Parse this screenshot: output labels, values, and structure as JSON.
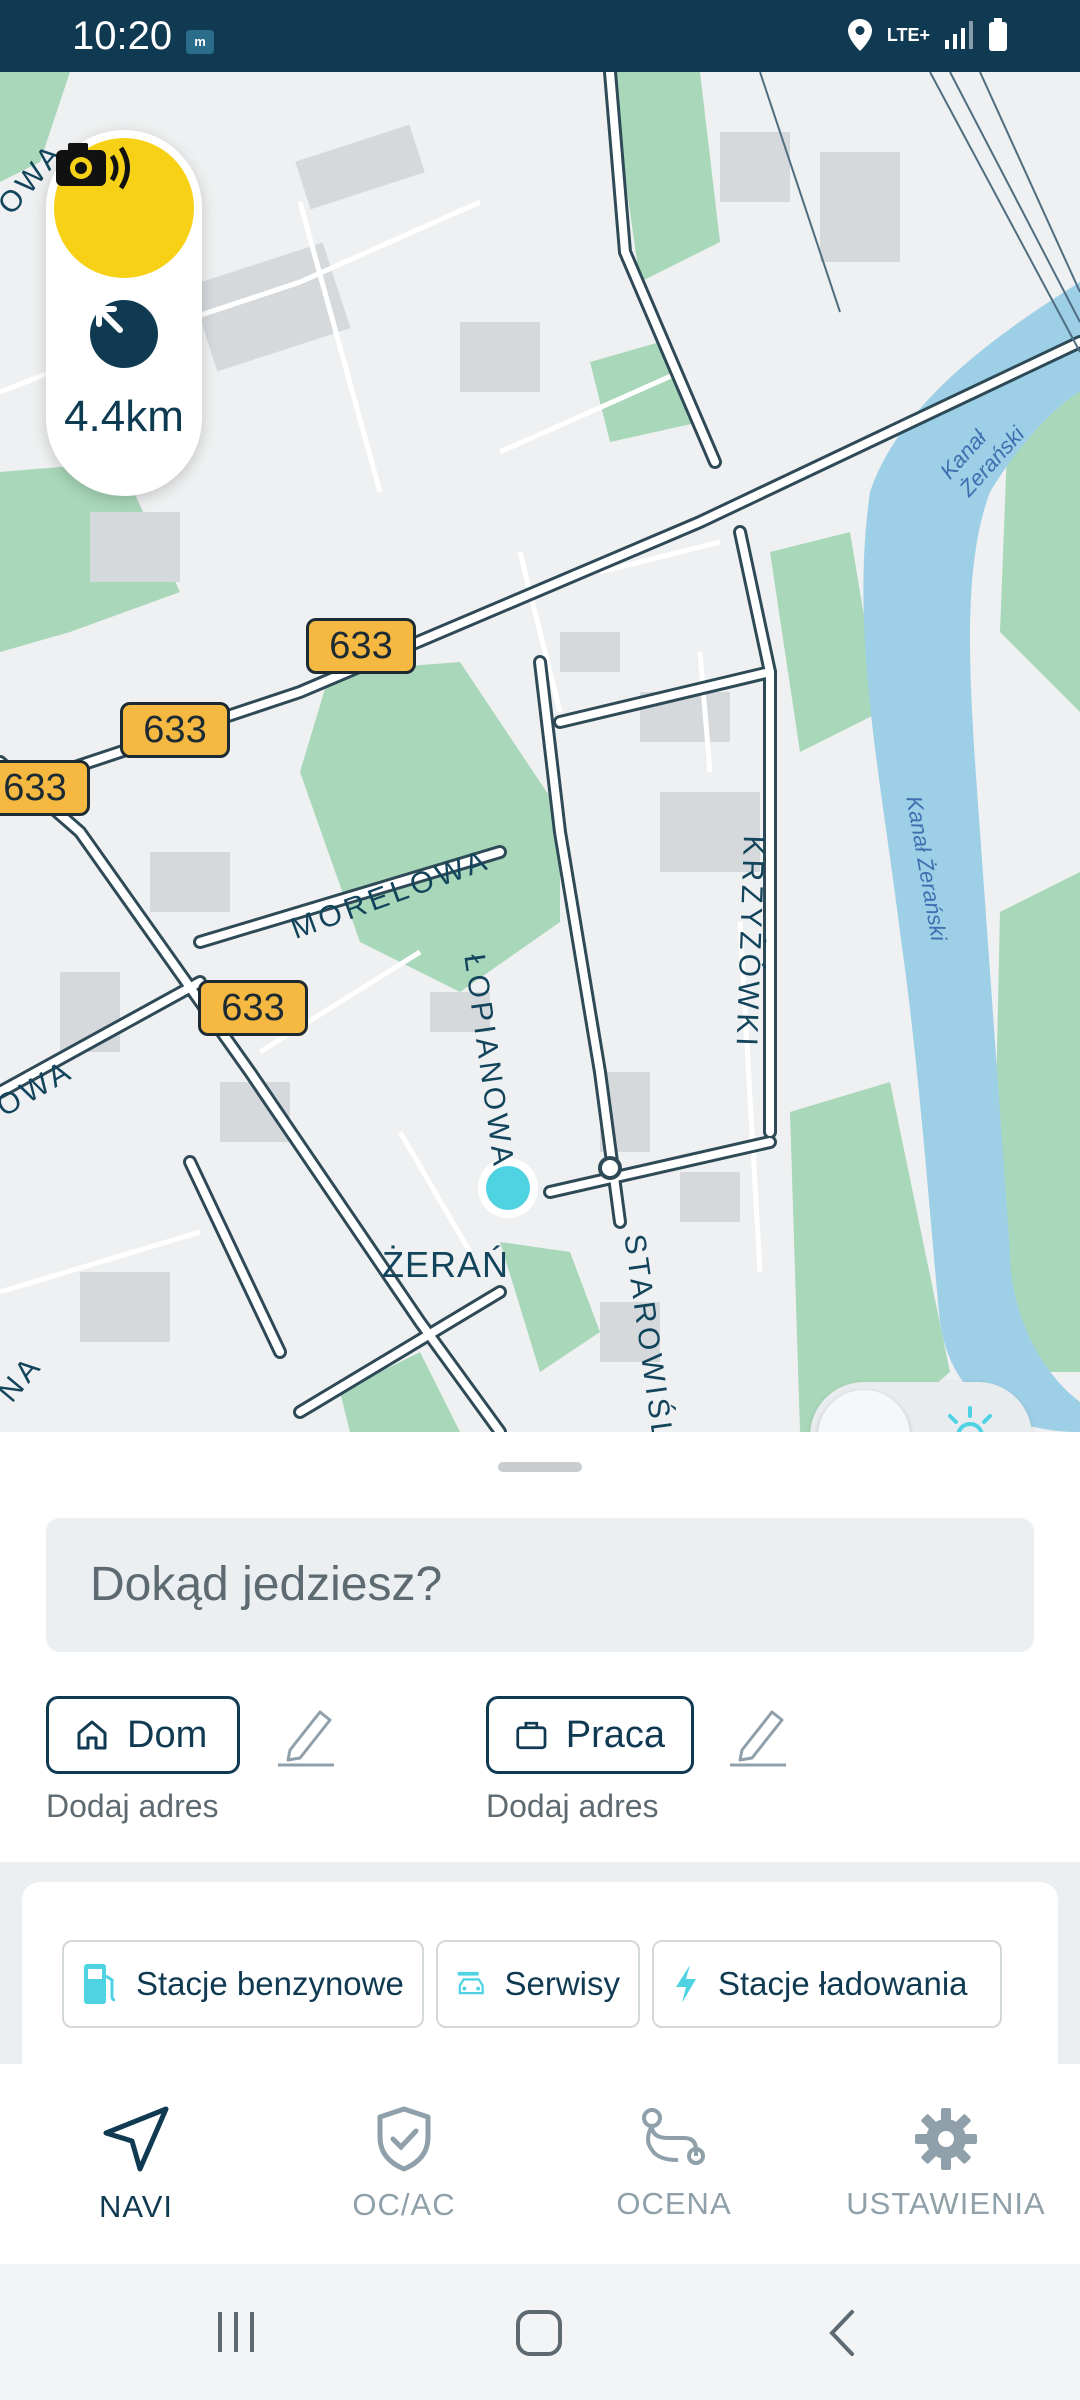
{
  "status_bar": {
    "time": "10:20",
    "notification_badge": "m",
    "network": "LTE+"
  },
  "map": {
    "camera_widget": {
      "distance": "4.4km"
    },
    "road_badges": [
      "633",
      "633",
      "633",
      "633"
    ],
    "street_labels": [
      "MORELOWA",
      "ŁOPIANOWA",
      "KRZYŻÓWKI",
      "STAROWIŚLNA",
      "OWA",
      "OWA",
      "NA"
    ],
    "district_label": "ŻERAŃ",
    "water_labels": [
      "Kanał Żerański",
      "Kanał Żerański"
    ],
    "theme_toggle": {
      "mode": "light"
    }
  },
  "search": {
    "placeholder": "Dokąd jedziesz?"
  },
  "favorites": [
    {
      "label": "Dom",
      "sub": "Dodaj adres",
      "icon": "home-icon"
    },
    {
      "label": "Praca",
      "sub": "Dodaj adres",
      "icon": "briefcase-icon"
    }
  ],
  "categories": [
    {
      "label": "Stacje benzynowe",
      "icon": "fuel-pump-icon"
    },
    {
      "label": "Serwisy",
      "icon": "car-service-icon"
    },
    {
      "label": "Stacje ładowania",
      "icon": "lightning-icon"
    }
  ],
  "bottom_nav": [
    {
      "label": "NAVI",
      "active": true,
      "icon": "navigation-arrow-icon"
    },
    {
      "label": "OC/AC",
      "active": false,
      "icon": "shield-check-icon"
    },
    {
      "label": "OCENA",
      "active": false,
      "icon": "route-icon"
    },
    {
      "label": "USTAWIENIA",
      "active": false,
      "icon": "gear-icon"
    }
  ],
  "colors": {
    "primary": "#0f3a52",
    "accent_cyan": "#4fd3e3",
    "camera_yellow": "#f6d116",
    "road_badge": "#f5b942",
    "park_green": "#a9d7b9",
    "water_blue": "#9dcfe7",
    "inactive": "#8fa0aa"
  }
}
